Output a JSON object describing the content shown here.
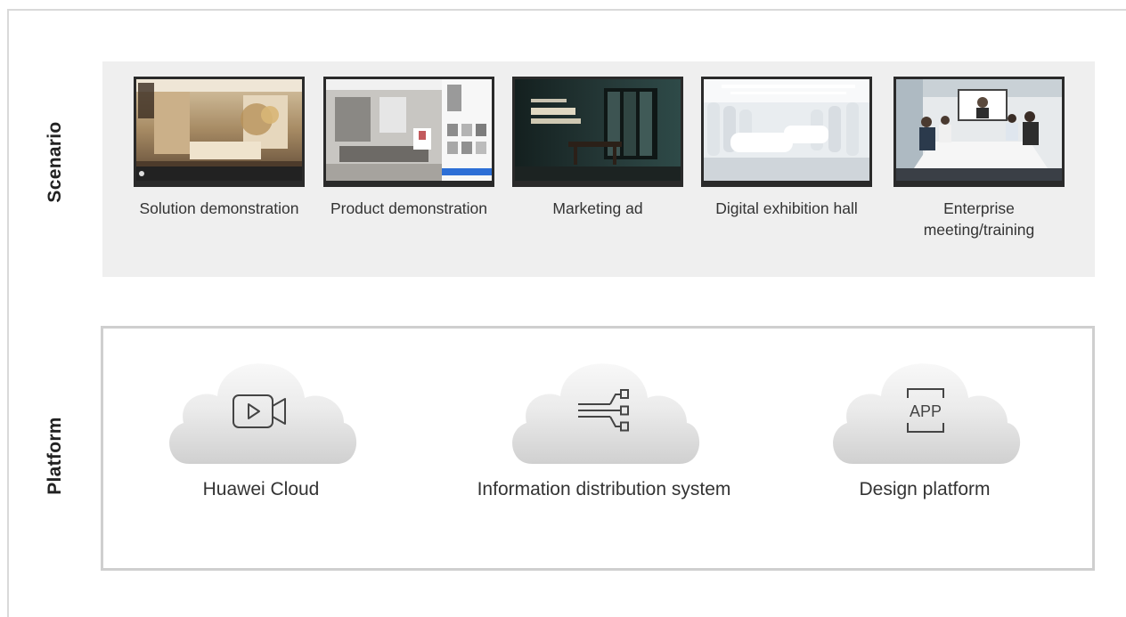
{
  "rows": {
    "scenario_label": "Scenario",
    "platform_label": "Platform"
  },
  "scenarios": [
    {
      "caption": "Solution demonstration",
      "image": "living-room-interior",
      "colors": [
        "#6b5a44",
        "#c9b08a",
        "#e8dcc5"
      ]
    },
    {
      "caption": "Product demonstration",
      "image": "modern-room-with-product-panel",
      "colors": [
        "#8d8a85",
        "#d8d6d2",
        "#f4f4f4"
      ]
    },
    {
      "caption": "Marketing ad",
      "image": "dark-showroom-ad",
      "colors": [
        "#1a2426",
        "#2f4c4b",
        "#7a8c88"
      ]
    },
    {
      "caption": "Digital exhibition hall",
      "image": "white-exhibition-hall",
      "colors": [
        "#cfd6dc",
        "#eef1f4",
        "#ffffff"
      ]
    },
    {
      "caption": "Enterprise meeting/training",
      "image": "meeting-room-video-conference",
      "colors": [
        "#b9c4cc",
        "#eef0f2",
        "#3a3f46"
      ]
    }
  ],
  "platforms": [
    {
      "caption": "Huawei Cloud",
      "icon": "video-camera-icon"
    },
    {
      "caption": "Information distribution system",
      "icon": "distribution-icon"
    },
    {
      "caption": "Design platform",
      "icon": "app-icon",
      "icon_text": "APP"
    }
  ],
  "colors": {
    "scenario_bg": "#efefef",
    "platform_border": "#cfcfcf",
    "cloud_top": "#f7f7f7",
    "cloud_bottom": "#d2d2d2"
  }
}
